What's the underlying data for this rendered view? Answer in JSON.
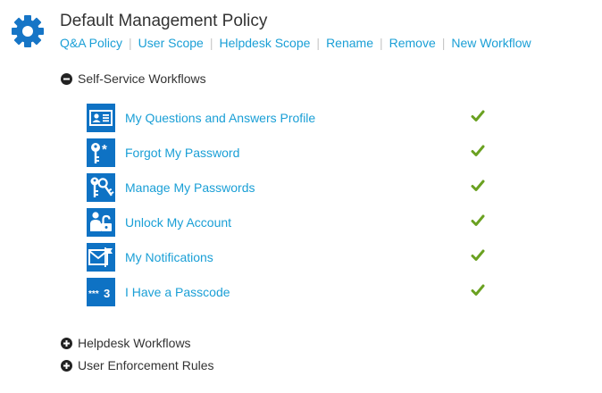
{
  "policy": {
    "title": "Default Management Policy",
    "icon": "gear-icon",
    "links": [
      "Q&A Policy",
      "User Scope",
      "Helpdesk Scope",
      "Rename",
      "Remove",
      "New Workflow"
    ]
  },
  "sections": {
    "self_service": {
      "label": "Self-Service Workflows",
      "state": "expanded",
      "icon": "minus-circle-icon"
    },
    "helpdesk": {
      "label": "Helpdesk Workflows",
      "state": "collapsed",
      "icon": "plus-circle-icon"
    },
    "enforcement": {
      "label": "User Enforcement Rules",
      "state": "collapsed",
      "icon": "plus-circle-icon"
    }
  },
  "workflows": [
    {
      "label": "My Questions and Answers Profile",
      "icon": "id-card-icon",
      "enabled": true
    },
    {
      "label": "Forgot My Password",
      "icon": "key-asterisk-icon",
      "enabled": true
    },
    {
      "label": "Manage My Passwords",
      "icon": "keys-icon",
      "enabled": true
    },
    {
      "label": "Unlock My Account",
      "icon": "user-unlock-icon",
      "enabled": true
    },
    {
      "label": "My Notifications",
      "icon": "envelope-icon",
      "enabled": true
    },
    {
      "label": "I Have a Passcode",
      "icon": "passcode-icon",
      "enabled": true
    }
  ],
  "colors": {
    "accent": "#1a9fd6",
    "icon_bg": "#0e72c4",
    "check": "#6aa121",
    "gear": "#1675c6"
  }
}
